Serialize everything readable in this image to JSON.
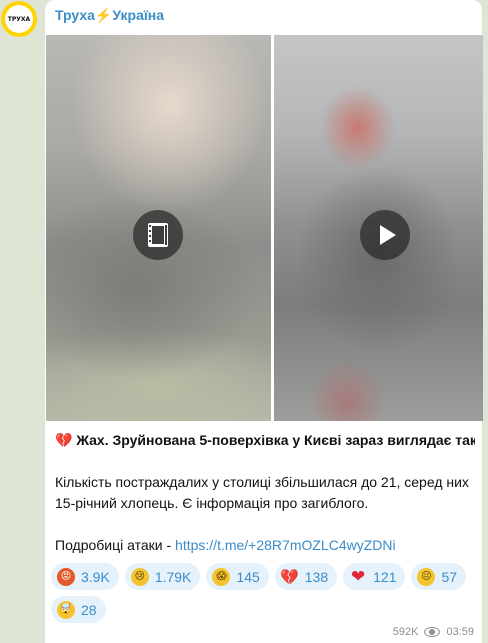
{
  "post": {
    "avatar_text": "ТРУХА",
    "channel_name": "Труха⚡Україна",
    "headline": "💔 Жах. Зруйнована 5-поверхівка у Києві зараз виглядає так…",
    "paragraph": "Кількість постраждалих у столиці збільшилася до 21, серед них 15-річний хлопець. Є інформація про загиблого.",
    "details_prefix": "Подробиці атаки - ",
    "details_link": "https://t.me/+28R7mOZLC4wyZDNi",
    "views": "592K",
    "time": "03:59"
  },
  "reactions": [
    {
      "icon": "angry-face",
      "glyph": "😡",
      "count": "3.9K"
    },
    {
      "icon": "crying-face",
      "glyph": "😢",
      "count": "1.79K"
    },
    {
      "icon": "screaming-face",
      "glyph": "😱",
      "count": "145"
    },
    {
      "icon": "broken-heart",
      "glyph": "💔",
      "count": "138"
    },
    {
      "icon": "red-heart",
      "glyph": "❤",
      "count": "121"
    },
    {
      "icon": "neutral-face",
      "glyph": "😐",
      "count": "57"
    },
    {
      "icon": "exploding-head",
      "glyph": "🤯",
      "count": "28"
    }
  ],
  "colors": {
    "accent": "#3a8dc9",
    "background": "#dfe5d5",
    "avatar_ring": "#ffd400"
  }
}
